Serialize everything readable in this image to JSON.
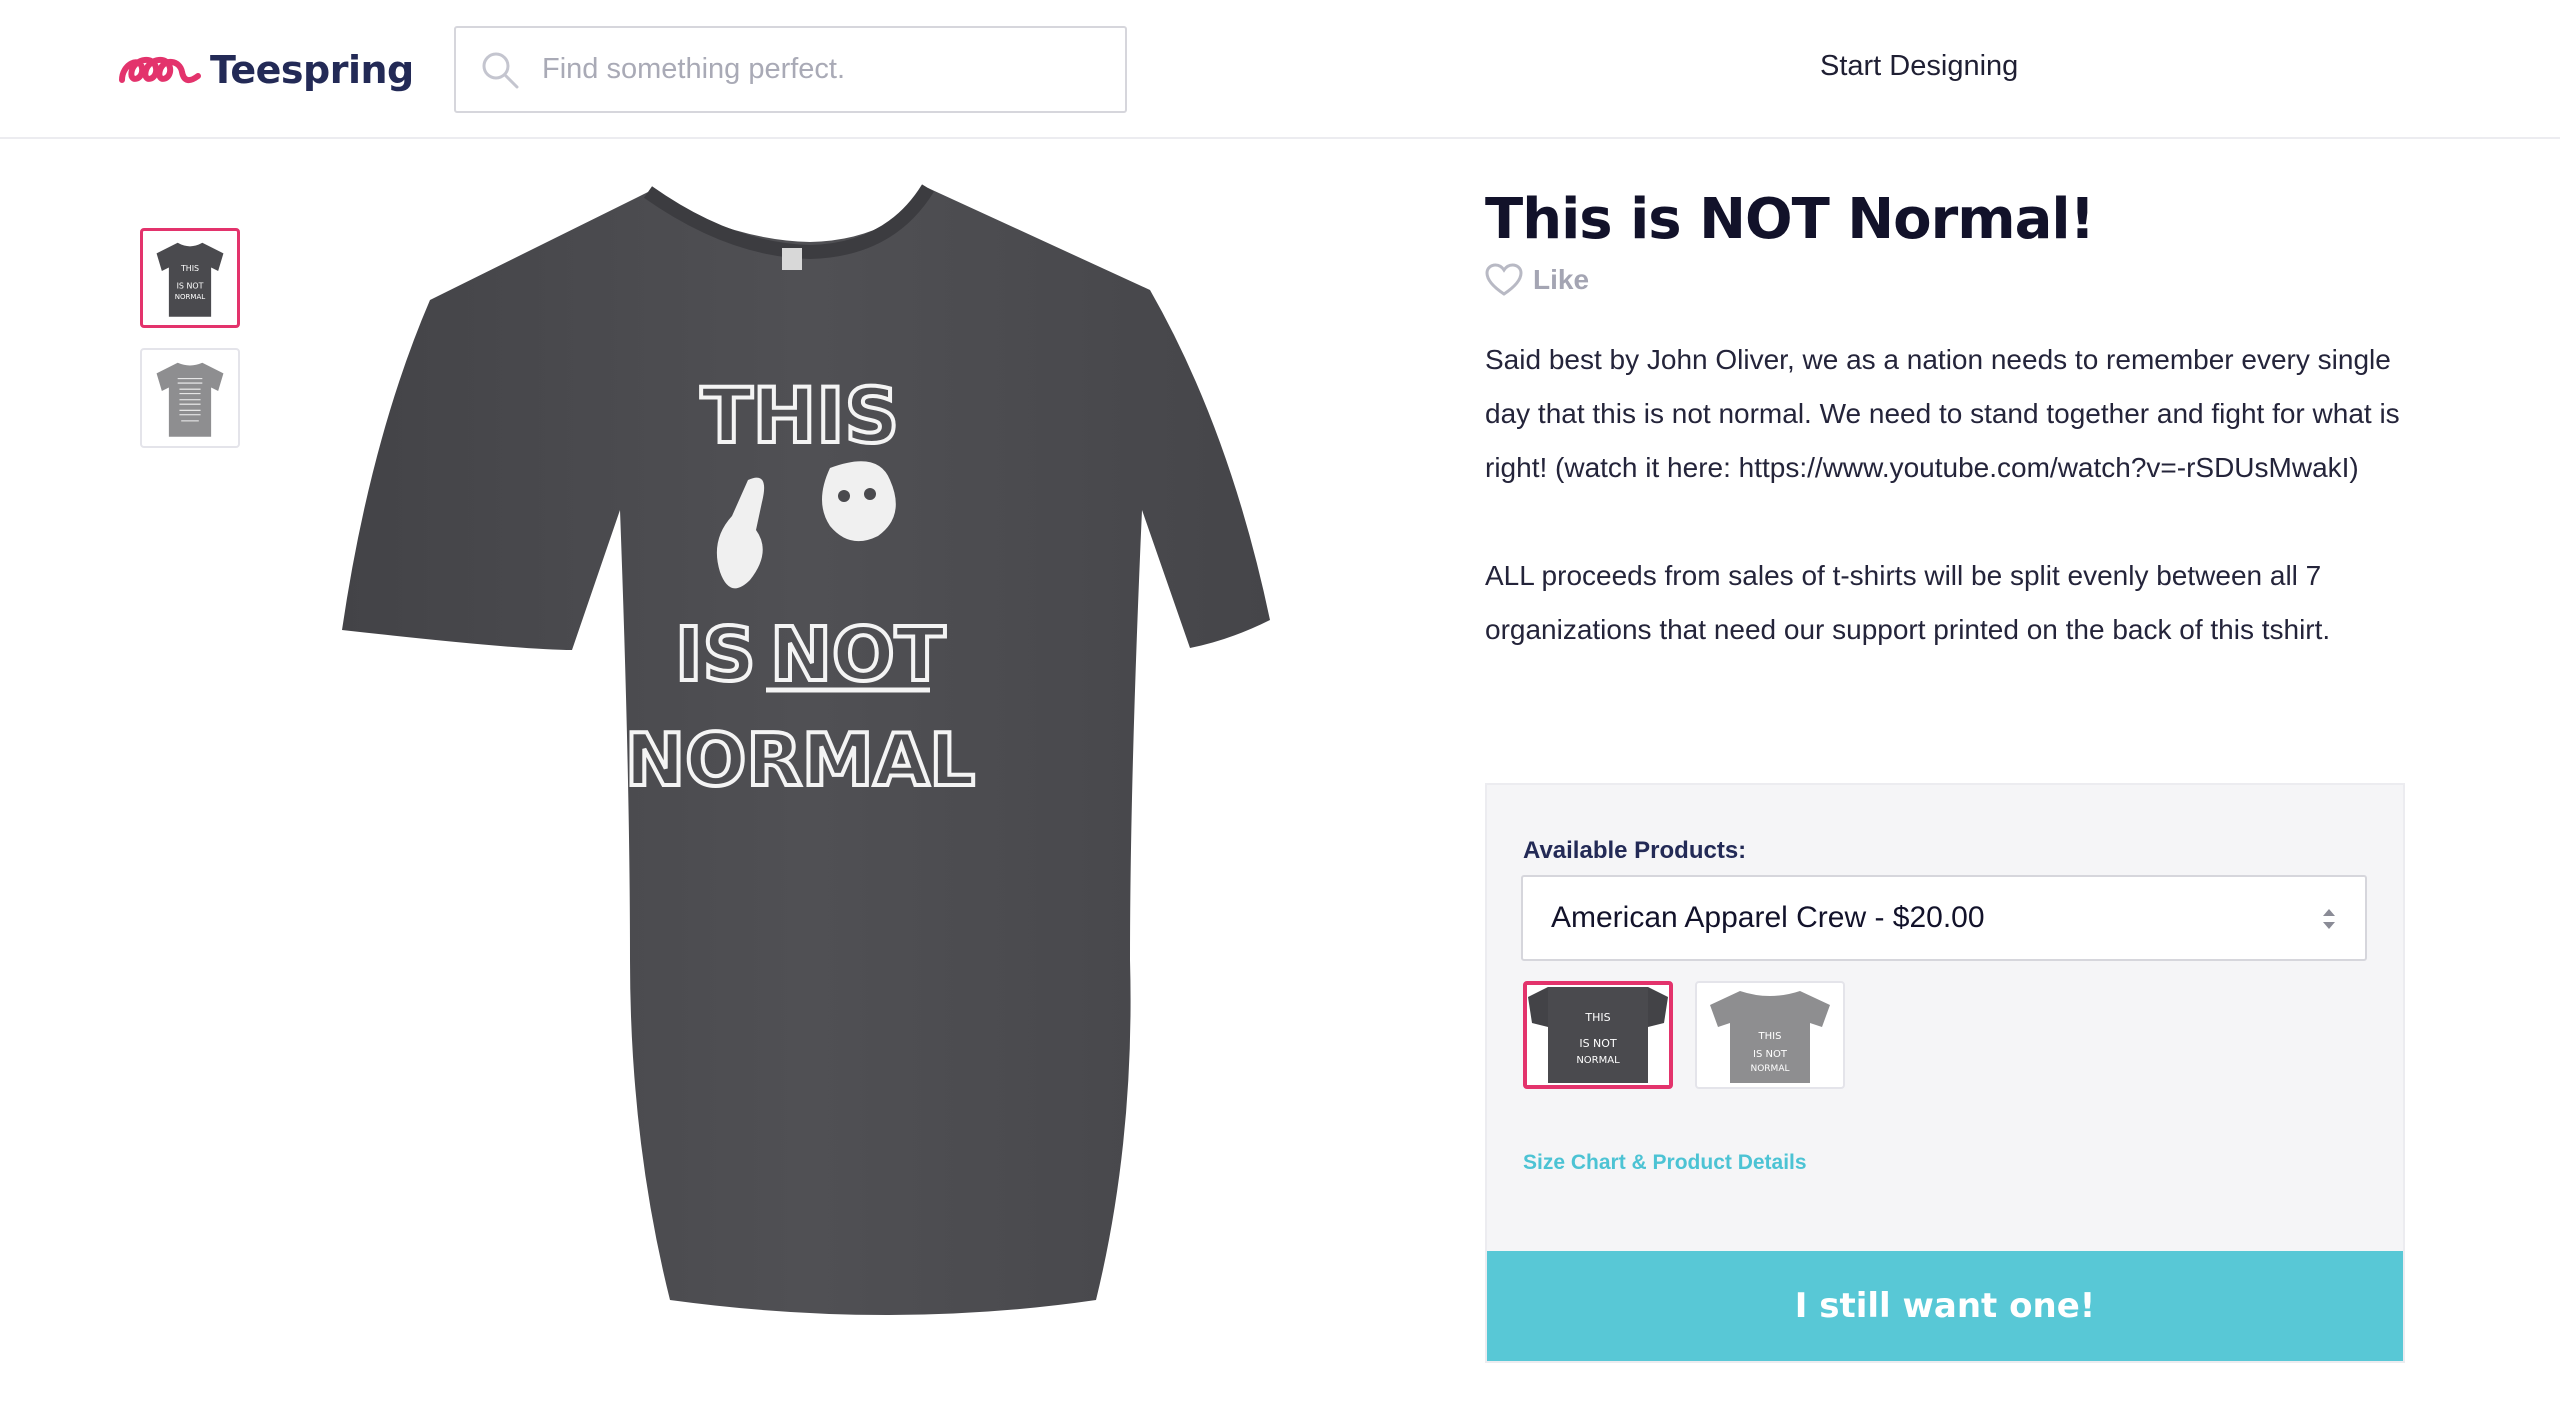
{
  "header": {
    "brand": "Teespring",
    "search_placeholder": "Find something perfect.",
    "nav_link": "Start Designing"
  },
  "colors": {
    "brand_pink": "#e3336c",
    "brand_navy": "#232a56",
    "cta": "#58c8d6",
    "shirt_dark": "#4a4a4e",
    "shirt_light": "#8e8e90"
  },
  "product": {
    "title": "This is NOT Normal!",
    "like_label": "Like",
    "description": [
      "Said best by John Oliver, we as a nation needs to remember every single day that this is not normal. We need to stand together and fight for what is right! (watch it here: https://www.youtube.com/watch?v=-rSDUsMwakI)",
      "ALL proceeds from sales of t-shirts will be split evenly between all 7 organizations that need our support printed on the back of this tshirt."
    ],
    "shirt_print": {
      "line1": "THIS",
      "line2a": "IS ",
      "line2b": "NOT",
      "line3": "NORMAL"
    },
    "thumbnails": [
      {
        "icon": "dark-shirt-front",
        "selected": true
      },
      {
        "icon": "grey-shirt-back",
        "selected": false
      }
    ]
  },
  "purchase": {
    "available_label": "Available Products:",
    "selected_product": "American Apparel Crew - $20.00",
    "swatches": [
      {
        "color": "dark heather",
        "selected": true
      },
      {
        "color": "grey",
        "selected": false
      }
    ],
    "size_link": "Size Chart & Product Details",
    "cta": "I still want one!"
  }
}
